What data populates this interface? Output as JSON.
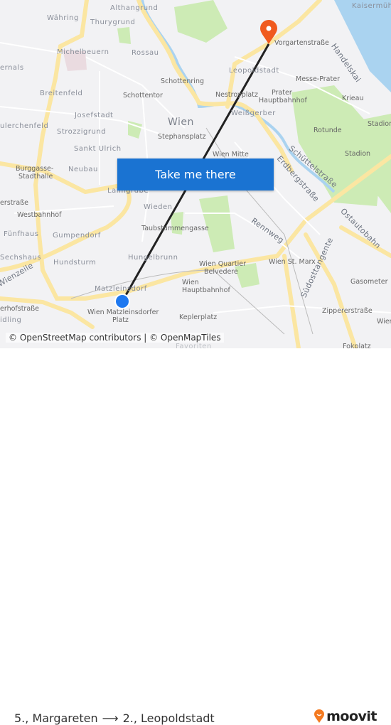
{
  "map": {
    "labels": {
      "wahring": "Währing",
      "althangrund": "Althangrund",
      "thurygrund": "Thurygrund",
      "michelbeuern": "Michelbeuern",
      "rossau": "Rossau",
      "hernals": "ernals",
      "schottenring": "Schottenring",
      "breitenfeld": "Breitenfeld",
      "schottentor": "Schottentor",
      "josefstadt": "Josefstadt",
      "wien": "Wien",
      "strozzigrund": "Strozzigrund",
      "stephansplatz": "Stephansplatz",
      "lerchenfeld": "ulerchenfeld",
      "sankt_ulrich": "Sankt Ulrich",
      "burggasse": "Burggasse-",
      "stadthalle": "Stadthalle",
      "neubau": "Neubau",
      "laimgrube": "Laimgrube",
      "erstrasse": "erstraße",
      "westbahnhof": "Westbahnhof",
      "wieden": "Wieden",
      "taubstummengasse": "Taubstummengasse",
      "funfhaus": "Fünfhaus",
      "gumpendorf": "Gumpendorf",
      "sechshaus": "Sechshaus",
      "hundsturm": "Hundsturm",
      "hungelbrunn": "Hungelbrunn",
      "wienzeile": "Wienzeile",
      "matzleinsdorf": "Matzleinsdorf",
      "matz_platz_1": "Wien Matzleinsdorfer",
      "matz_platz_2": "Platz",
      "erhofstrasse": "erhofstraße",
      "meidling": "idling",
      "keplerplatz": "Keplerplatz",
      "hbf_1": "Wien",
      "hbf_2": "Hauptbahnhof",
      "belvedere_1": "Wien Quartier",
      "belvedere_2": "Belvedere",
      "st_marx": "Wien St. Marx",
      "rennweg": "Rennweg",
      "erdbergstrasse": "Erdbergstraße",
      "sudosttangente": "Südosttangente",
      "ostautobahn": "Ostautobahn",
      "gasometer": "Gasometer",
      "zippererstrasse": "Zippererstraße",
      "wien_se": "Wien",
      "stadion_1": "Stadion",
      "stadion_2": "Stadion",
      "rotunde": "Rotunde",
      "krieau": "Krieau",
      "messe_prater": "Messe-Prater",
      "prater_1": "Prater",
      "prater_2": "Hauptbahnhof",
      "nestroyplatz": "Nestroyplatz",
      "weissgerber": "Weißgerber",
      "leopoldstadt": "Leopoldstadt",
      "vorgartenstrasse": "Vorgartenstraße",
      "handelskai": "Handelskai",
      "kaisermuhlen": "Kaisermühlen",
      "schuttelstrasse": "Schüttelstraße",
      "wien_mitte": "Wien Mitte",
      "favoriten": "Favoriten",
      "fokplatz": "Fokplatz"
    },
    "cta_label": "Take me there",
    "attribution": "© OpenStreetMap contributors | © OpenMapTiles",
    "colors": {
      "route": "#222222",
      "origin": "#1e78f0",
      "destination": "#f05a1e",
      "button": "#1a73d2",
      "road": "#fbe6a2",
      "water": "#aad3f0",
      "park": "#cdebb5"
    }
  },
  "footer": {
    "origin": "5., Margareten",
    "arrow": "⟶",
    "destination": "2., Leopoldstadt",
    "brand": "moovit"
  }
}
